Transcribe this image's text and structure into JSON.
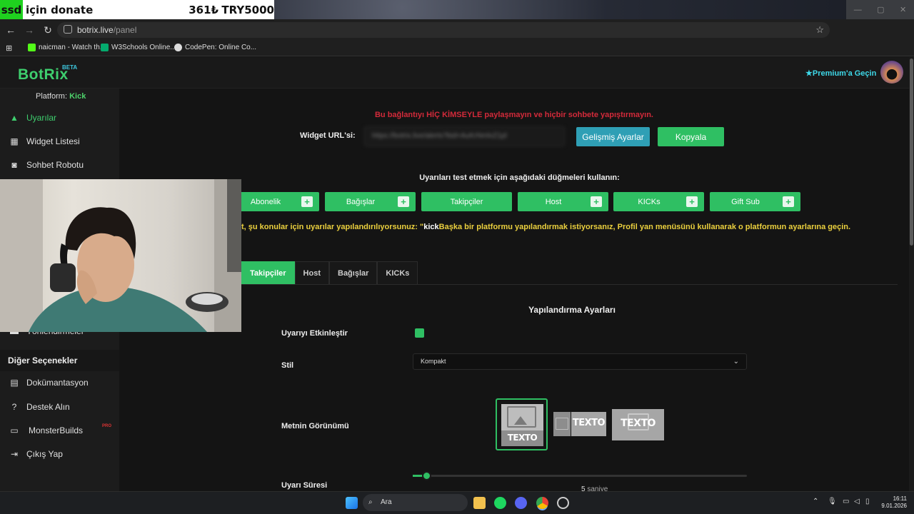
{
  "overlay": {
    "tag": "ssd",
    "who": "için donate",
    "amount": "361₺",
    "currency": "TRY5000"
  },
  "browser": {
    "url_host": "botrix.live",
    "url_path": "/panel",
    "bookmarks": [
      "naicman - Watch th...",
      "W3Schools Online...",
      "CodePen: Online Co..."
    ]
  },
  "app": {
    "logo": "BotRix",
    "beta": "BETA",
    "premium": "Premium'a Geçin",
    "platform_label": "Platform:",
    "platform_value": "Kick"
  },
  "sidebar": {
    "items": [
      {
        "label": "Uyarılar",
        "icon": "warning-icon"
      },
      {
        "label": "Widget Listesi",
        "icon": "grid-icon"
      },
      {
        "label": "Sohbet Robotu",
        "icon": "robot-icon"
      },
      {
        "label": "Yönlendirmeler",
        "icon": "users-icon"
      }
    ],
    "other_header": "Diğer Seçenekler",
    "other_items": [
      {
        "label": "Dokümantasyon",
        "icon": "document-icon"
      },
      {
        "label": "Destek Alın",
        "icon": "question-icon"
      },
      {
        "label": "MonsterBuilds",
        "icon": "monitor-icon"
      },
      {
        "label": "Çıkış Yap",
        "icon": "logout-icon"
      }
    ],
    "pro_badge": "PRO"
  },
  "main": {
    "warning": "Bu bağlantıyı HİÇ KİMSEYLE paylaşmayın ve hiçbir sohbete yapıştırmayın.",
    "widget_url_label": "Widget URL'si:",
    "widget_url_value": "https://botrix.live/alerts?bid=AuKrNmlvZ1pl",
    "advanced_button": "Gelişmiş Ayarlar",
    "copy_button": "Kopyala",
    "test_header": "Uyarıları test etmek için aşağıdaki düğmeleri kullanın:",
    "test_buttons": [
      "Abonelik",
      "Bağışlar",
      "Takipçiler",
      "Host",
      "KICKs",
      "Gift Sub"
    ],
    "info_prefix": "t, şu konular için uyarılar yapılandırılıyorsunuz: \"",
    "info_bold": "kick",
    "info_rest": "Başka bir platformu yapılandırmak istiyorsanız, Profil yan menüsünü kullanarak o platformun ayarlarına geçin.",
    "tabs": [
      "Takipçiler",
      "Host",
      "Bağışlar",
      "KICKs"
    ],
    "config_title": "Yapılandırma Ayarları",
    "enable_label": "Uyarıyı Etkinleştir",
    "style_label": "Stil",
    "style_value": "Kompakt",
    "text_view_label": "Metnin Görünümü",
    "texto": "TEXTO",
    "duration_label": "Uyarı Süresi",
    "duration_value": "5",
    "duration_unit": "saniye",
    "duration_fraction": 0.04
  },
  "taskbar": {
    "search": "Ara",
    "time": "16:11",
    "date": "9.01.2026"
  },
  "colors": {
    "brand_green": "#2fbf63",
    "info_blue": "#2f9fb5",
    "warning_red": "#d32a3a",
    "notice_yellow": "#ebd03e"
  }
}
